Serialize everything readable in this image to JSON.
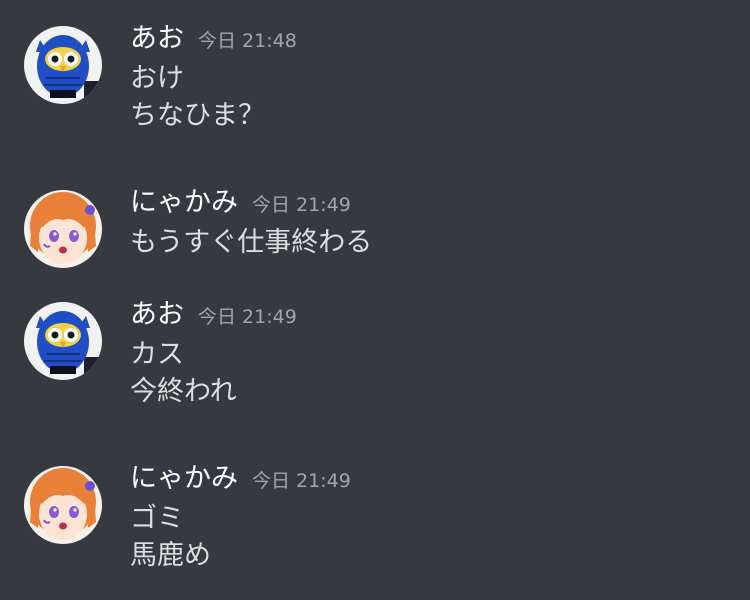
{
  "messages": [
    {
      "username": "あお",
      "timestamp": "今日 21:48",
      "avatar": "owl-avatar",
      "lines": [
        "おけ",
        "ちなひま？"
      ]
    },
    {
      "username": "にゃかみ",
      "timestamp": "今日 21:49",
      "avatar": "anime-girl-avatar",
      "lines": [
        "もうすぐ仕事終わる"
      ]
    },
    {
      "username": "あお",
      "timestamp": "今日 21:49",
      "avatar": "owl-avatar",
      "lines": [
        "カス",
        "今終われ"
      ]
    },
    {
      "username": "にゃかみ",
      "timestamp": "今日 21:49",
      "avatar": "anime-girl-avatar",
      "lines": [
        "ゴミ",
        "馬鹿め"
      ]
    }
  ],
  "colors": {
    "background": "#36393f",
    "username": "#ffffff",
    "message_text": "#dcddde",
    "timestamp": "#a3a6aa"
  }
}
